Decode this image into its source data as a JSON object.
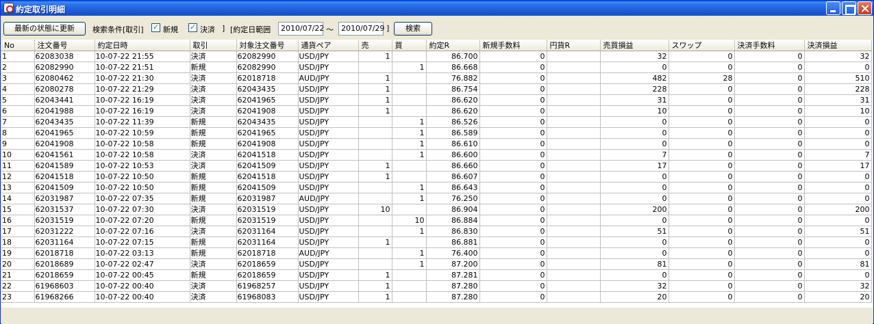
{
  "window": {
    "title": "約定取引明細"
  },
  "toolbar": {
    "refresh_label": "最新の状態に更新",
    "search_condition_label": "検索条件[取引]",
    "new_label": "新規",
    "settle_label": "決済",
    "bracket_close": "]",
    "date_range_label": "[約定日範囲",
    "date_from": "2010/07/22",
    "tilde": "～",
    "date_to": "2010/07/29",
    "bracket_close2": "]",
    "search_label": "検索",
    "new_checked": true,
    "settle_checked": true
  },
  "table": {
    "columns": [
      "No",
      "注文番号",
      "約定日時",
      "取引",
      "対象注文番号",
      "通貨ペア",
      "売",
      "買",
      "約定R",
      "新規手数料",
      "円貨R",
      "売買損益",
      "スワップ",
      "決済手数料",
      "決済損益"
    ],
    "rows": [
      [
        "1",
        "62083038",
        "10-07-22 21:55",
        "決済",
        "62082990",
        "USD/JPY",
        "1",
        "",
        "86.700",
        "0",
        "",
        "32",
        "0",
        "0",
        "32"
      ],
      [
        "2",
        "62082990",
        "10-07-22 21:51",
        "新規",
        "62082990",
        "USD/JPY",
        "",
        "1",
        "86.668",
        "0",
        "",
        "0",
        "0",
        "0",
        "0"
      ],
      [
        "3",
        "62080462",
        "10-07-22 21:30",
        "決済",
        "62018718",
        "AUD/JPY",
        "1",
        "",
        "76.882",
        "0",
        "",
        "482",
        "28",
        "0",
        "510"
      ],
      [
        "4",
        "62080278",
        "10-07-22 21:29",
        "決済",
        "62043435",
        "USD/JPY",
        "1",
        "",
        "86.754",
        "0",
        "",
        "228",
        "0",
        "0",
        "228"
      ],
      [
        "5",
        "62043441",
        "10-07-22 16:19",
        "決済",
        "62041965",
        "USD/JPY",
        "1",
        "",
        "86.620",
        "0",
        "",
        "31",
        "0",
        "0",
        "31"
      ],
      [
        "6",
        "62041988",
        "10-07-22 16:19",
        "決済",
        "62041908",
        "USD/JPY",
        "1",
        "",
        "86.620",
        "0",
        "",
        "10",
        "0",
        "0",
        "10"
      ],
      [
        "7",
        "62043435",
        "10-07-22 11:39",
        "新規",
        "62043435",
        "USD/JPY",
        "",
        "1",
        "86.526",
        "0",
        "",
        "0",
        "0",
        "0",
        "0"
      ],
      [
        "8",
        "62041965",
        "10-07-22 10:59",
        "新規",
        "62041965",
        "USD/JPY",
        "",
        "1",
        "86.589",
        "0",
        "",
        "0",
        "0",
        "0",
        "0"
      ],
      [
        "9",
        "62041908",
        "10-07-22 10:58",
        "新規",
        "62041908",
        "USD/JPY",
        "",
        "1",
        "86.610",
        "0",
        "",
        "0",
        "0",
        "0",
        "0"
      ],
      [
        "10",
        "62041561",
        "10-07-22 10:58",
        "決済",
        "62041518",
        "USD/JPY",
        "",
        "1",
        "86.600",
        "0",
        "",
        "7",
        "0",
        "0",
        "7"
      ],
      [
        "11",
        "62041589",
        "10-07-22 10:53",
        "決済",
        "62041509",
        "USD/JPY",
        "1",
        "",
        "86.660",
        "0",
        "",
        "17",
        "0",
        "0",
        "17"
      ],
      [
        "12",
        "62041518",
        "10-07-22 10:50",
        "新規",
        "62041518",
        "USD/JPY",
        "1",
        "",
        "86.607",
        "0",
        "",
        "0",
        "0",
        "0",
        "0"
      ],
      [
        "13",
        "62041509",
        "10-07-22 10:50",
        "新規",
        "62041509",
        "USD/JPY",
        "",
        "1",
        "86.643",
        "0",
        "",
        "0",
        "0",
        "0",
        "0"
      ],
      [
        "14",
        "62031987",
        "10-07-22 07:35",
        "新規",
        "62031987",
        "AUD/JPY",
        "",
        "1",
        "76.250",
        "0",
        "",
        "0",
        "0",
        "0",
        "0"
      ],
      [
        "15",
        "62031537",
        "10-07-22 07:30",
        "決済",
        "62031519",
        "USD/JPY",
        "10",
        "",
        "86.904",
        "0",
        "",
        "200",
        "0",
        "0",
        "200"
      ],
      [
        "16",
        "62031519",
        "10-07-22 07:20",
        "新規",
        "62031519",
        "USD/JPY",
        "",
        "10",
        "86.884",
        "0",
        "",
        "0",
        "0",
        "0",
        "0"
      ],
      [
        "17",
        "62031222",
        "10-07-22 07:16",
        "決済",
        "62031164",
        "USD/JPY",
        "",
        "1",
        "86.830",
        "0",
        "",
        "51",
        "0",
        "0",
        "51"
      ],
      [
        "18",
        "62031164",
        "10-07-22 07:15",
        "新規",
        "62031164",
        "USD/JPY",
        "1",
        "",
        "86.881",
        "0",
        "",
        "0",
        "0",
        "0",
        "0"
      ],
      [
        "19",
        "62018718",
        "10-07-22 03:13",
        "新規",
        "62018718",
        "AUD/JPY",
        "",
        "1",
        "76.400",
        "0",
        "",
        "0",
        "0",
        "0",
        "0"
      ],
      [
        "20",
        "62018689",
        "10-07-22 02:47",
        "決済",
        "62018659",
        "USD/JPY",
        "",
        "1",
        "87.200",
        "0",
        "",
        "81",
        "0",
        "0",
        "81"
      ],
      [
        "21",
        "62018659",
        "10-07-22 00:45",
        "新規",
        "62018659",
        "USD/JPY",
        "1",
        "",
        "87.281",
        "0",
        "",
        "0",
        "0",
        "0",
        "0"
      ],
      [
        "22",
        "61968603",
        "10-07-22 00:40",
        "決済",
        "61968257",
        "USD/JPY",
        "1",
        "",
        "87.280",
        "0",
        "",
        "32",
        "0",
        "0",
        "32"
      ],
      [
        "23",
        "61968266",
        "10-07-22 00:40",
        "決済",
        "61968083",
        "USD/JPY",
        "1",
        "",
        "87.280",
        "0",
        "",
        "20",
        "0",
        "0",
        "20"
      ]
    ]
  }
}
